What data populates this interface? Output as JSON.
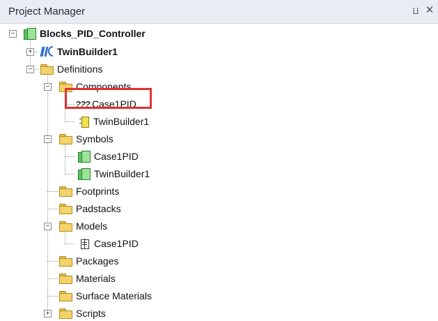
{
  "panel": {
    "title": "Project Manager",
    "pin_glyph": "⨿",
    "close_glyph": "✕"
  },
  "tree": {
    "root": {
      "label": "Blocks_PID_Controller",
      "toggle": "−"
    },
    "twinbuilder1": {
      "label": "TwinBuilder1",
      "toggle": "+"
    },
    "definitions": {
      "label": "Definitions",
      "toggle": "−"
    },
    "components": {
      "label": "Components",
      "toggle": "−"
    },
    "components_case1pid": {
      "label": "Case1PID",
      "icon_text": "???"
    },
    "components_twinbuilder1": {
      "label": "TwinBuilder1"
    },
    "symbols": {
      "label": "Symbols",
      "toggle": "−"
    },
    "symbols_case1pid": {
      "label": "Case1PID"
    },
    "symbols_twinbuilder1": {
      "label": "TwinBuilder1"
    },
    "footprints": {
      "label": "Footprints"
    },
    "padstacks": {
      "label": "Padstacks"
    },
    "models": {
      "label": "Models",
      "toggle": "−"
    },
    "models_case1pid": {
      "label": "Case1PID"
    },
    "packages": {
      "label": "Packages"
    },
    "materials": {
      "label": "Materials"
    },
    "surface_materials": {
      "label": "Surface Materials"
    },
    "scripts": {
      "label": "Scripts",
      "toggle": "+"
    }
  },
  "colors": {
    "highlight": "#e0322f",
    "titlebar": "#e9edf3"
  }
}
